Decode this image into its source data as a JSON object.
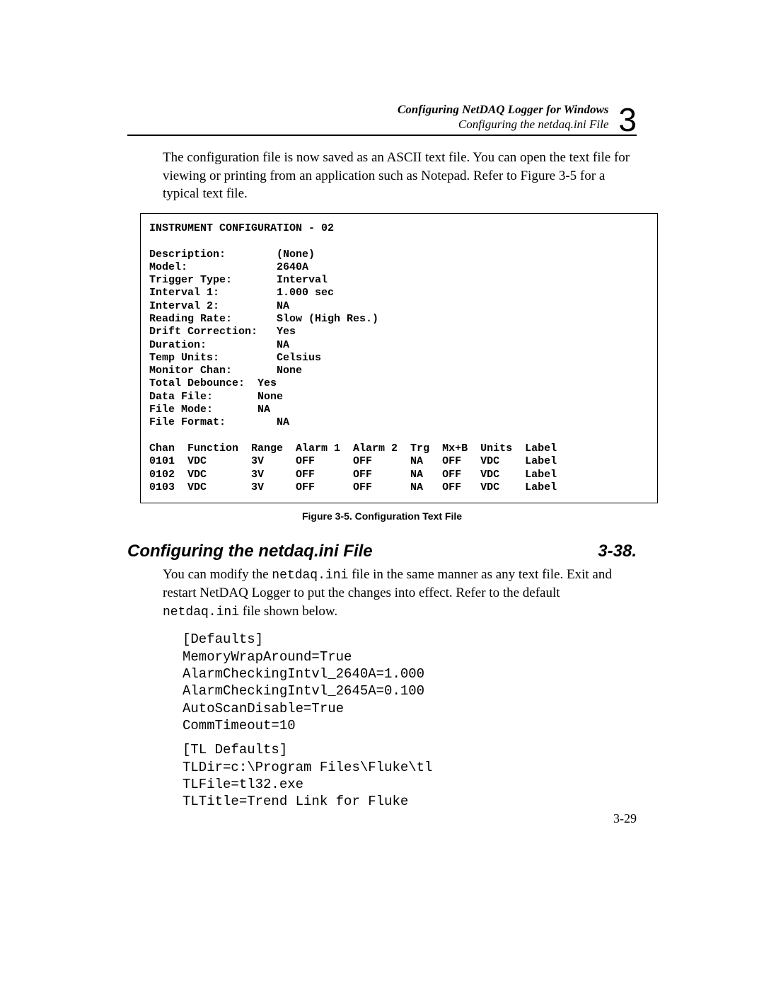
{
  "header": {
    "title": "Configuring NetDAQ Logger for Windows",
    "subtitle": "Configuring the netdaq.ini File",
    "chapter": "3"
  },
  "paragraph1": "The configuration file is now saved as an ASCII text file. You can open the text file for viewing or printing from an application such as Notepad. Refer to Figure 3-5 for a typical text file.",
  "figure": {
    "caption": "Figure 3-5. Configuration Text File",
    "heading": "INSTRUMENT CONFIGURATION - 02",
    "rows": [
      {
        "k": "Description:",
        "v": "(None)"
      },
      {
        "k": "Model:",
        "v": "2640A"
      },
      {
        "k": "Trigger Type:",
        "v": "Interval"
      },
      {
        "k": "Interval 1:",
        "v": "1.000 sec"
      },
      {
        "k": "Interval 2:",
        "v": "NA"
      },
      {
        "k": "Reading Rate:",
        "v": "Slow (High Res.)"
      },
      {
        "k": "Drift Correction:",
        "v": "Yes"
      },
      {
        "k": "Duration:",
        "v": "NA"
      },
      {
        "k": "Temp Units:",
        "v": "Celsius"
      },
      {
        "k": "Monitor Chan:",
        "v": "None"
      },
      {
        "k": "Total Debounce:",
        "v": "Yes",
        "short": true
      },
      {
        "k": "Data File:",
        "v": "None",
        "short": true
      },
      {
        "k": "File Mode:",
        "v": "NA",
        "short": true
      },
      {
        "k": "File Format:",
        "v": "NA"
      }
    ],
    "table_header": [
      "Chan",
      "Function",
      "Range",
      "Alarm 1",
      "Alarm 2",
      "Trg",
      "Mx+B",
      "Units",
      "Label"
    ],
    "table_rows": [
      [
        "0101",
        "VDC",
        "3V",
        "OFF",
        "OFF",
        "NA",
        "OFF",
        "VDC",
        "Label"
      ],
      [
        "0102",
        "VDC",
        "3V",
        "OFF",
        "OFF",
        "NA",
        "OFF",
        "VDC",
        "Label"
      ],
      [
        "0103",
        "VDC",
        "3V",
        "OFF",
        "OFF",
        "NA",
        "OFF",
        "VDC",
        "Label"
      ]
    ]
  },
  "section": {
    "title": "Configuring the netdaq.ini File",
    "number": "3-38."
  },
  "paragraph2": {
    "pre": "You can modify the ",
    "file1": "netdaq.ini",
    "mid": " file in the same manner as any text file. Exit and restart NetDAQ Logger to put the changes into effect. Refer to the default ",
    "file2": "netdaq.ini",
    "post": " file shown below."
  },
  "ini": {
    "block1_header": "[Defaults]",
    "block1_lines": [
      "MemoryWrapAround=True",
      "AlarmCheckingIntvl_2640A=1.000",
      "AlarmCheckingIntvl_2645A=0.100",
      "AutoScanDisable=True",
      "CommTimeout=10"
    ],
    "block2_header": "[TL Defaults]",
    "block2_lines": [
      "TLDir=c:\\Program Files\\Fluke\\tl",
      "TLFile=tl32.exe",
      "TLTitle=Trend Link for Fluke"
    ]
  },
  "page_number": "3-29"
}
